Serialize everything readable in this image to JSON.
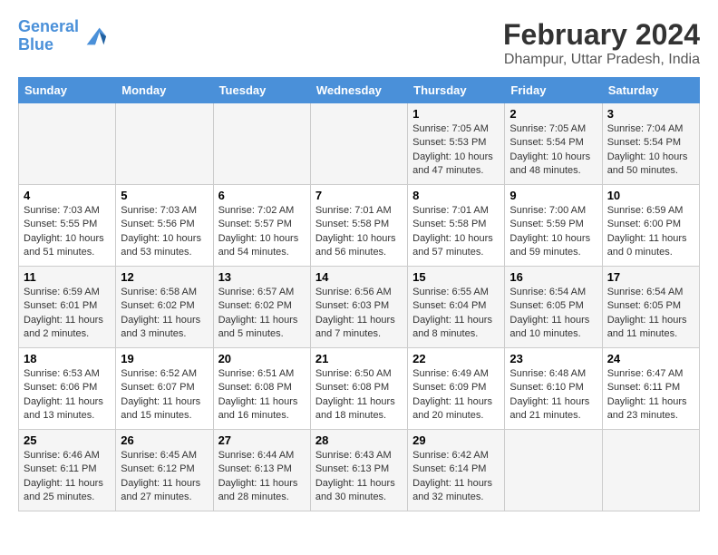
{
  "header": {
    "logo_line1": "General",
    "logo_line2": "Blue",
    "title": "February 2024",
    "subtitle": "Dhampur, Uttar Pradesh, India"
  },
  "columns": [
    "Sunday",
    "Monday",
    "Tuesday",
    "Wednesday",
    "Thursday",
    "Friday",
    "Saturday"
  ],
  "weeks": [
    [
      {
        "day": "",
        "info": ""
      },
      {
        "day": "",
        "info": ""
      },
      {
        "day": "",
        "info": ""
      },
      {
        "day": "",
        "info": ""
      },
      {
        "day": "1",
        "info": "Sunrise: 7:05 AM\nSunset: 5:53 PM\nDaylight: 10 hours\nand 47 minutes."
      },
      {
        "day": "2",
        "info": "Sunrise: 7:05 AM\nSunset: 5:54 PM\nDaylight: 10 hours\nand 48 minutes."
      },
      {
        "day": "3",
        "info": "Sunrise: 7:04 AM\nSunset: 5:54 PM\nDaylight: 10 hours\nand 50 minutes."
      }
    ],
    [
      {
        "day": "4",
        "info": "Sunrise: 7:03 AM\nSunset: 5:55 PM\nDaylight: 10 hours\nand 51 minutes."
      },
      {
        "day": "5",
        "info": "Sunrise: 7:03 AM\nSunset: 5:56 PM\nDaylight: 10 hours\nand 53 minutes."
      },
      {
        "day": "6",
        "info": "Sunrise: 7:02 AM\nSunset: 5:57 PM\nDaylight: 10 hours\nand 54 minutes."
      },
      {
        "day": "7",
        "info": "Sunrise: 7:01 AM\nSunset: 5:58 PM\nDaylight: 10 hours\nand 56 minutes."
      },
      {
        "day": "8",
        "info": "Sunrise: 7:01 AM\nSunset: 5:58 PM\nDaylight: 10 hours\nand 57 minutes."
      },
      {
        "day": "9",
        "info": "Sunrise: 7:00 AM\nSunset: 5:59 PM\nDaylight: 10 hours\nand 59 minutes."
      },
      {
        "day": "10",
        "info": "Sunrise: 6:59 AM\nSunset: 6:00 PM\nDaylight: 11 hours\nand 0 minutes."
      }
    ],
    [
      {
        "day": "11",
        "info": "Sunrise: 6:59 AM\nSunset: 6:01 PM\nDaylight: 11 hours\nand 2 minutes."
      },
      {
        "day": "12",
        "info": "Sunrise: 6:58 AM\nSunset: 6:02 PM\nDaylight: 11 hours\nand 3 minutes."
      },
      {
        "day": "13",
        "info": "Sunrise: 6:57 AM\nSunset: 6:02 PM\nDaylight: 11 hours\nand 5 minutes."
      },
      {
        "day": "14",
        "info": "Sunrise: 6:56 AM\nSunset: 6:03 PM\nDaylight: 11 hours\nand 7 minutes."
      },
      {
        "day": "15",
        "info": "Sunrise: 6:55 AM\nSunset: 6:04 PM\nDaylight: 11 hours\nand 8 minutes."
      },
      {
        "day": "16",
        "info": "Sunrise: 6:54 AM\nSunset: 6:05 PM\nDaylight: 11 hours\nand 10 minutes."
      },
      {
        "day": "17",
        "info": "Sunrise: 6:54 AM\nSunset: 6:05 PM\nDaylight: 11 hours\nand 11 minutes."
      }
    ],
    [
      {
        "day": "18",
        "info": "Sunrise: 6:53 AM\nSunset: 6:06 PM\nDaylight: 11 hours\nand 13 minutes."
      },
      {
        "day": "19",
        "info": "Sunrise: 6:52 AM\nSunset: 6:07 PM\nDaylight: 11 hours\nand 15 minutes."
      },
      {
        "day": "20",
        "info": "Sunrise: 6:51 AM\nSunset: 6:08 PM\nDaylight: 11 hours\nand 16 minutes."
      },
      {
        "day": "21",
        "info": "Sunrise: 6:50 AM\nSunset: 6:08 PM\nDaylight: 11 hours\nand 18 minutes."
      },
      {
        "day": "22",
        "info": "Sunrise: 6:49 AM\nSunset: 6:09 PM\nDaylight: 11 hours\nand 20 minutes."
      },
      {
        "day": "23",
        "info": "Sunrise: 6:48 AM\nSunset: 6:10 PM\nDaylight: 11 hours\nand 21 minutes."
      },
      {
        "day": "24",
        "info": "Sunrise: 6:47 AM\nSunset: 6:11 PM\nDaylight: 11 hours\nand 23 minutes."
      }
    ],
    [
      {
        "day": "25",
        "info": "Sunrise: 6:46 AM\nSunset: 6:11 PM\nDaylight: 11 hours\nand 25 minutes."
      },
      {
        "day": "26",
        "info": "Sunrise: 6:45 AM\nSunset: 6:12 PM\nDaylight: 11 hours\nand 27 minutes."
      },
      {
        "day": "27",
        "info": "Sunrise: 6:44 AM\nSunset: 6:13 PM\nDaylight: 11 hours\nand 28 minutes."
      },
      {
        "day": "28",
        "info": "Sunrise: 6:43 AM\nSunset: 6:13 PM\nDaylight: 11 hours\nand 30 minutes."
      },
      {
        "day": "29",
        "info": "Sunrise: 6:42 AM\nSunset: 6:14 PM\nDaylight: 11 hours\nand 32 minutes."
      },
      {
        "day": "",
        "info": ""
      },
      {
        "day": "",
        "info": ""
      }
    ]
  ]
}
